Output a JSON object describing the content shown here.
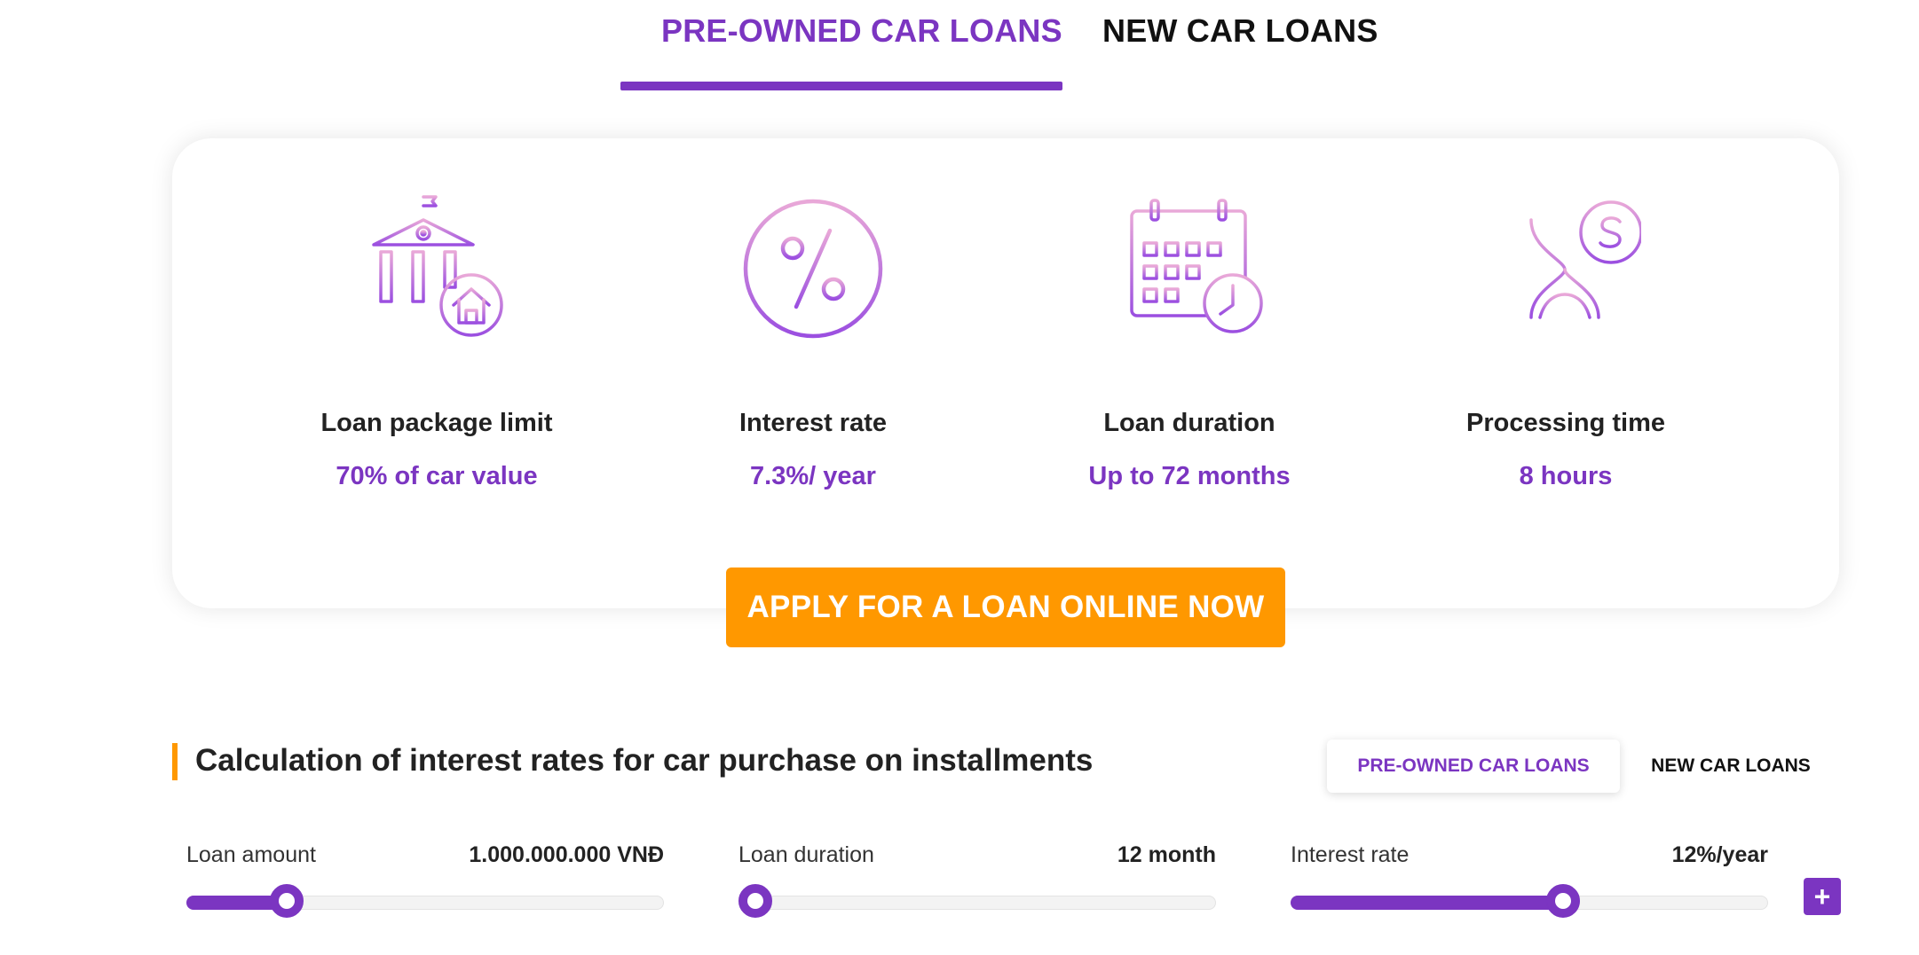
{
  "top_tabs": [
    {
      "label": "PRE-OWNED CAR LOANS",
      "active": true
    },
    {
      "label": "NEW CAR LOANS",
      "active": false
    }
  ],
  "features": [
    {
      "icon": "bank-house-icon",
      "title": "Loan package limit",
      "value": "70% of car value"
    },
    {
      "icon": "percent-icon",
      "title": "Interest rate",
      "value": "7.3%/ year"
    },
    {
      "icon": "calendar-clock-icon",
      "title": "Loan duration",
      "value": "Up to 72 months"
    },
    {
      "icon": "hourglass-dollar-icon",
      "title": "Processing time",
      "value": "8 hours"
    }
  ],
  "apply_button": "APPLY FOR A LOAN ONLINE NOW",
  "calculator": {
    "title": "Calculation of interest rates for car purchase on installments",
    "tabs": [
      {
        "label": "PRE-OWNED CAR LOANS",
        "active": true
      },
      {
        "label": "NEW CAR LOANS",
        "active": false
      }
    ],
    "sliders": [
      {
        "label": "Loan amount",
        "value": "1.000.000.000 VNĐ",
        "fraction": 0.21
      },
      {
        "label": "Loan duration",
        "value": "12 month",
        "fraction": 0.0
      },
      {
        "label": "Interest rate",
        "value": "12%/year",
        "fraction": 0.57
      }
    ],
    "plus_icon": "plus-icon"
  },
  "colors": {
    "accent": "#7b35c1",
    "cta": "#ff9800"
  }
}
